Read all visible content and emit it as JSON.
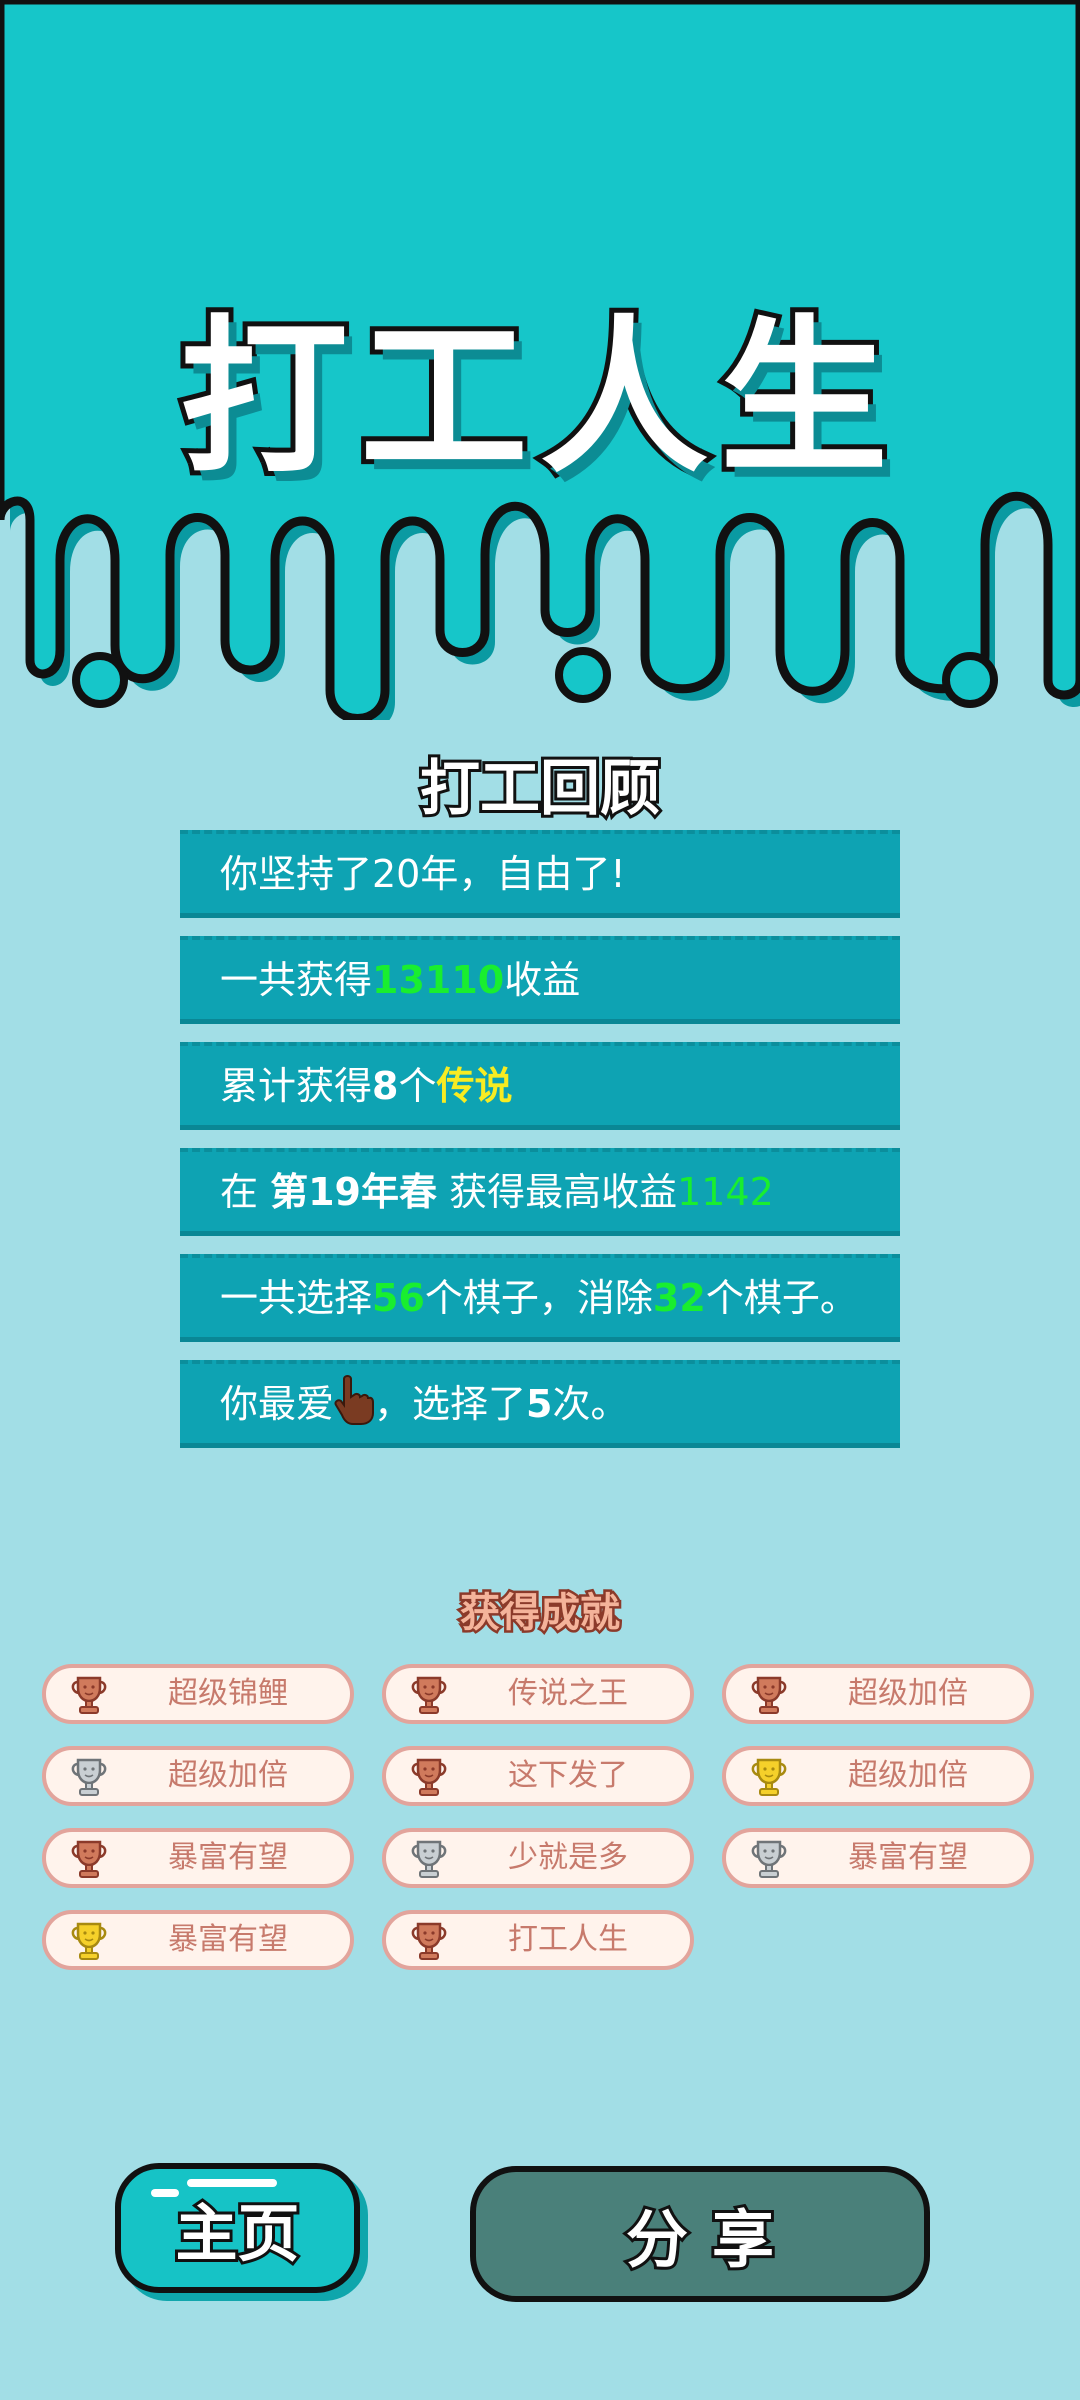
{
  "app_title": "打工人生",
  "review": {
    "title": "打工回顾",
    "rows": [
      {
        "text": "你坚持了20年，自由了!"
      },
      {
        "pre": "一共获得",
        "value": "13110",
        "post": "收益"
      },
      {
        "pre": "累计获得",
        "count": "8",
        "mid": "个",
        "tier": "传说"
      },
      {
        "pre": "在 ",
        "season": "第19年春",
        "mid": " 获得最高收益",
        "value": "1142"
      },
      {
        "pre": "一共选择",
        "value1": "56",
        "mid": "个棋子，消除",
        "value2": "32",
        "post": "个棋子。"
      },
      {
        "pre": "你最爱",
        "icon": "pointing-hand-icon",
        "mid": "，选择了",
        "count": "5",
        "post": "次。"
      }
    ]
  },
  "achievements": {
    "title": "获得成就",
    "items": [
      {
        "label": "超级锦鲤",
        "trophy": "bronze"
      },
      {
        "label": "传说之王",
        "trophy": "bronze"
      },
      {
        "label": "超级加倍",
        "trophy": "bronze"
      },
      {
        "label": "超级加倍",
        "trophy": "silver"
      },
      {
        "label": "这下发了",
        "trophy": "bronze"
      },
      {
        "label": "超级加倍",
        "trophy": "gold"
      },
      {
        "label": "暴富有望",
        "trophy": "bronze"
      },
      {
        "label": "少就是多",
        "trophy": "silver"
      },
      {
        "label": "暴富有望",
        "trophy": "silver"
      },
      {
        "label": "暴富有望",
        "trophy": "gold"
      },
      {
        "label": "打工人生",
        "trophy": "bronze"
      }
    ]
  },
  "buttons": {
    "home": "主页",
    "share": "分享"
  },
  "colors": {
    "page_bg": "#a2dee6",
    "header_bg": "#16c6c9",
    "row_bg": "#0ea3b3",
    "highlight_green": "#19ee2f",
    "highlight_yellow": "#f7ec22",
    "share_bg": "#4a807a"
  }
}
